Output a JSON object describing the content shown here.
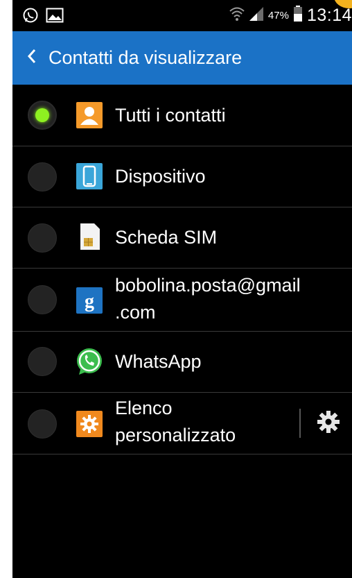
{
  "status_bar": {
    "battery_percent": "47%",
    "time": "13:14",
    "left_icons": [
      "whatsapp-notification-icon",
      "image-notification-icon"
    ],
    "right_icons": [
      "wifi-icon",
      "signal-icon",
      "battery-icon"
    ]
  },
  "header": {
    "title": "Contatti da visualizzare",
    "background": "#1b72c6",
    "back_icon": "chevron-left-icon"
  },
  "options": [
    {
      "label": "Tutti i contatti",
      "selected": true,
      "icon": "person-contact-icon"
    },
    {
      "label": "Dispositivo",
      "selected": false,
      "icon": "phone-device-icon"
    },
    {
      "label": "Scheda SIM",
      "selected": false,
      "icon": "sim-card-icon"
    },
    {
      "label_line1": "bobolina.posta@gmail",
      "label_line2": ".com",
      "selected": false,
      "icon": "google-account-icon"
    },
    {
      "label": "WhatsApp",
      "selected": false,
      "icon": "whatsapp-icon"
    },
    {
      "label_line1": "Elenco",
      "label_line2": "personalizzato",
      "selected": false,
      "icon": "custom-list-icon",
      "action_icon": "gear-icon"
    }
  ],
  "colors": {
    "accent": "#1b72c6",
    "radio_selected": "#8ef021",
    "background": "#000000"
  }
}
